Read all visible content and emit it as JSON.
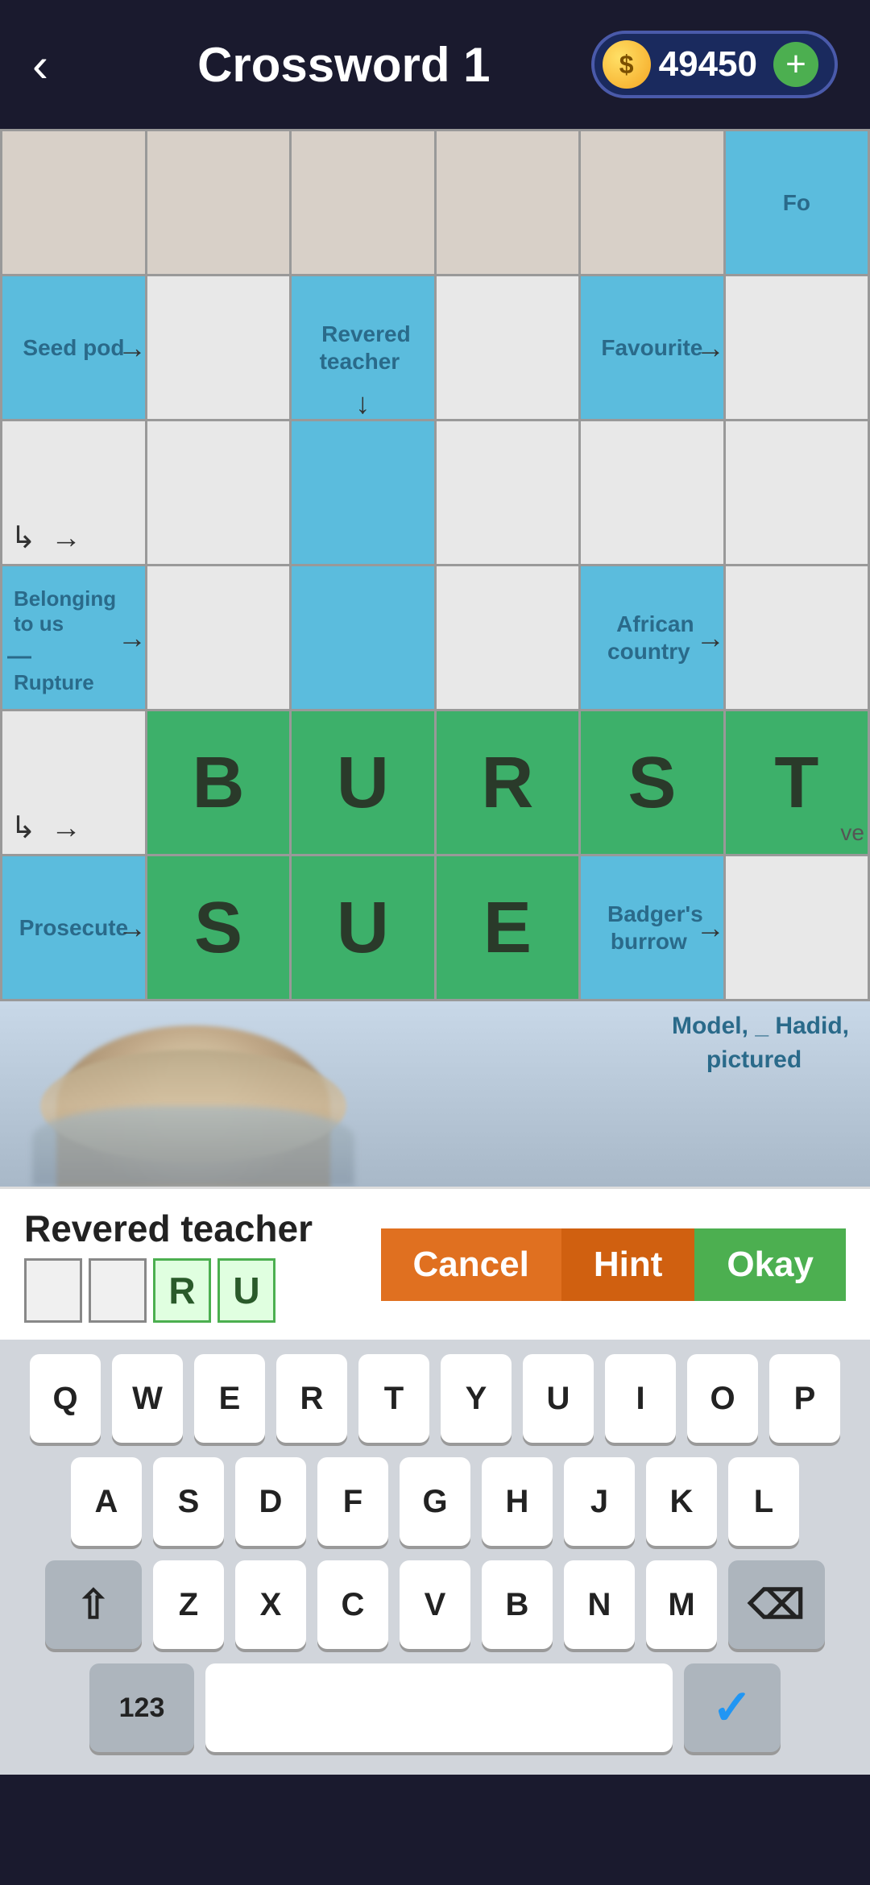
{
  "header": {
    "back_label": "‹",
    "title": "Crossword 1",
    "coins": "49450",
    "plus_label": "+"
  },
  "grid": {
    "rows": [
      [
        {
          "type": "empty",
          "text": ""
        },
        {
          "type": "empty",
          "text": ""
        },
        {
          "type": "empty",
          "text": ""
        },
        {
          "type": "empty",
          "text": ""
        },
        {
          "type": "empty",
          "text": ""
        },
        {
          "type": "blue",
          "text": "Fo"
        }
      ],
      [
        {
          "type": "blue",
          "text": "Seed pod",
          "arrow": "right"
        },
        {
          "type": "white",
          "text": ""
        },
        {
          "type": "blue",
          "text": "Revered teacher",
          "arrow": "down"
        },
        {
          "type": "white",
          "text": ""
        },
        {
          "type": "blue",
          "text": "Favourite",
          "arrow": "right"
        },
        {
          "type": "white",
          "text": ""
        }
      ],
      [
        {
          "type": "white",
          "text": "",
          "arrow_corner": true
        },
        {
          "type": "white",
          "text": ""
        },
        {
          "type": "blue",
          "text": ""
        },
        {
          "type": "white",
          "text": ""
        },
        {
          "type": "white",
          "text": ""
        },
        {
          "type": "white",
          "text": ""
        }
      ],
      [
        {
          "type": "blue",
          "text": "Belonging to us\n—\nRupture",
          "arrow": "right"
        },
        {
          "type": "white",
          "text": ""
        },
        {
          "type": "blue",
          "text": ""
        },
        {
          "type": "white",
          "text": ""
        },
        {
          "type": "blue",
          "text": "African country",
          "arrow": "right"
        },
        {
          "type": "white",
          "text": ""
        }
      ],
      [
        {
          "type": "white",
          "text": "",
          "arrow_corner": true
        },
        {
          "type": "green",
          "letter": "B"
        },
        {
          "type": "green",
          "letter": "U"
        },
        {
          "type": "green",
          "letter": "R"
        },
        {
          "type": "green",
          "letter": "S"
        },
        {
          "type": "green",
          "letter": "T",
          "partial": "ve"
        }
      ],
      [
        {
          "type": "blue",
          "text": "Prosecute",
          "arrow": "right"
        },
        {
          "type": "green",
          "letter": "S"
        },
        {
          "type": "green",
          "letter": "U"
        },
        {
          "type": "green",
          "letter": "E"
        },
        {
          "type": "blue",
          "text": "Badger's burrow",
          "arrow": "right"
        },
        {
          "type": "white",
          "text": ""
        }
      ]
    ]
  },
  "photo_clue": {
    "text": "Model, _ Hadid, pictured"
  },
  "clue_bar": {
    "label": "Revered teacher",
    "boxes": [
      "",
      "",
      "R",
      "U"
    ],
    "cancel": "Cancel",
    "hint": "Hint",
    "okay": "Okay"
  },
  "keyboard": {
    "rows": [
      [
        "Q",
        "W",
        "E",
        "R",
        "T",
        "Y",
        "U",
        "I",
        "O",
        "P"
      ],
      [
        "A",
        "S",
        "D",
        "F",
        "G",
        "H",
        "J",
        "K",
        "L"
      ],
      [
        "⇧",
        "Z",
        "X",
        "C",
        "V",
        "B",
        "N",
        "M",
        "⌫"
      ]
    ],
    "bottom_left": "123",
    "space": "",
    "bottom_right": "✓"
  }
}
